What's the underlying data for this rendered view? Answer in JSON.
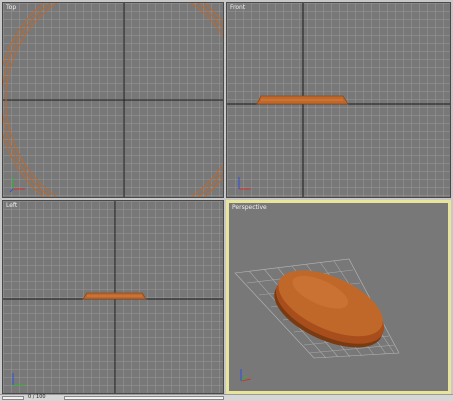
{
  "viewports": {
    "top": {
      "label": "Top"
    },
    "front": {
      "label": "Front"
    },
    "left": {
      "label": "Left"
    },
    "perspective": {
      "label": "Perspective",
      "active": true
    }
  },
  "colors": {
    "viewport_bg": "#787878",
    "grid_line": "#969696",
    "axis_line": "#1a1a1a",
    "object_wire": "#c0682a",
    "object_fill": "#b8602a",
    "active_border": "#e8e49a",
    "axis_x": "#d83030",
    "axis_y": "#30b030",
    "axis_z": "#3050e0"
  },
  "statusbar": {
    "text": "0 / 100"
  }
}
